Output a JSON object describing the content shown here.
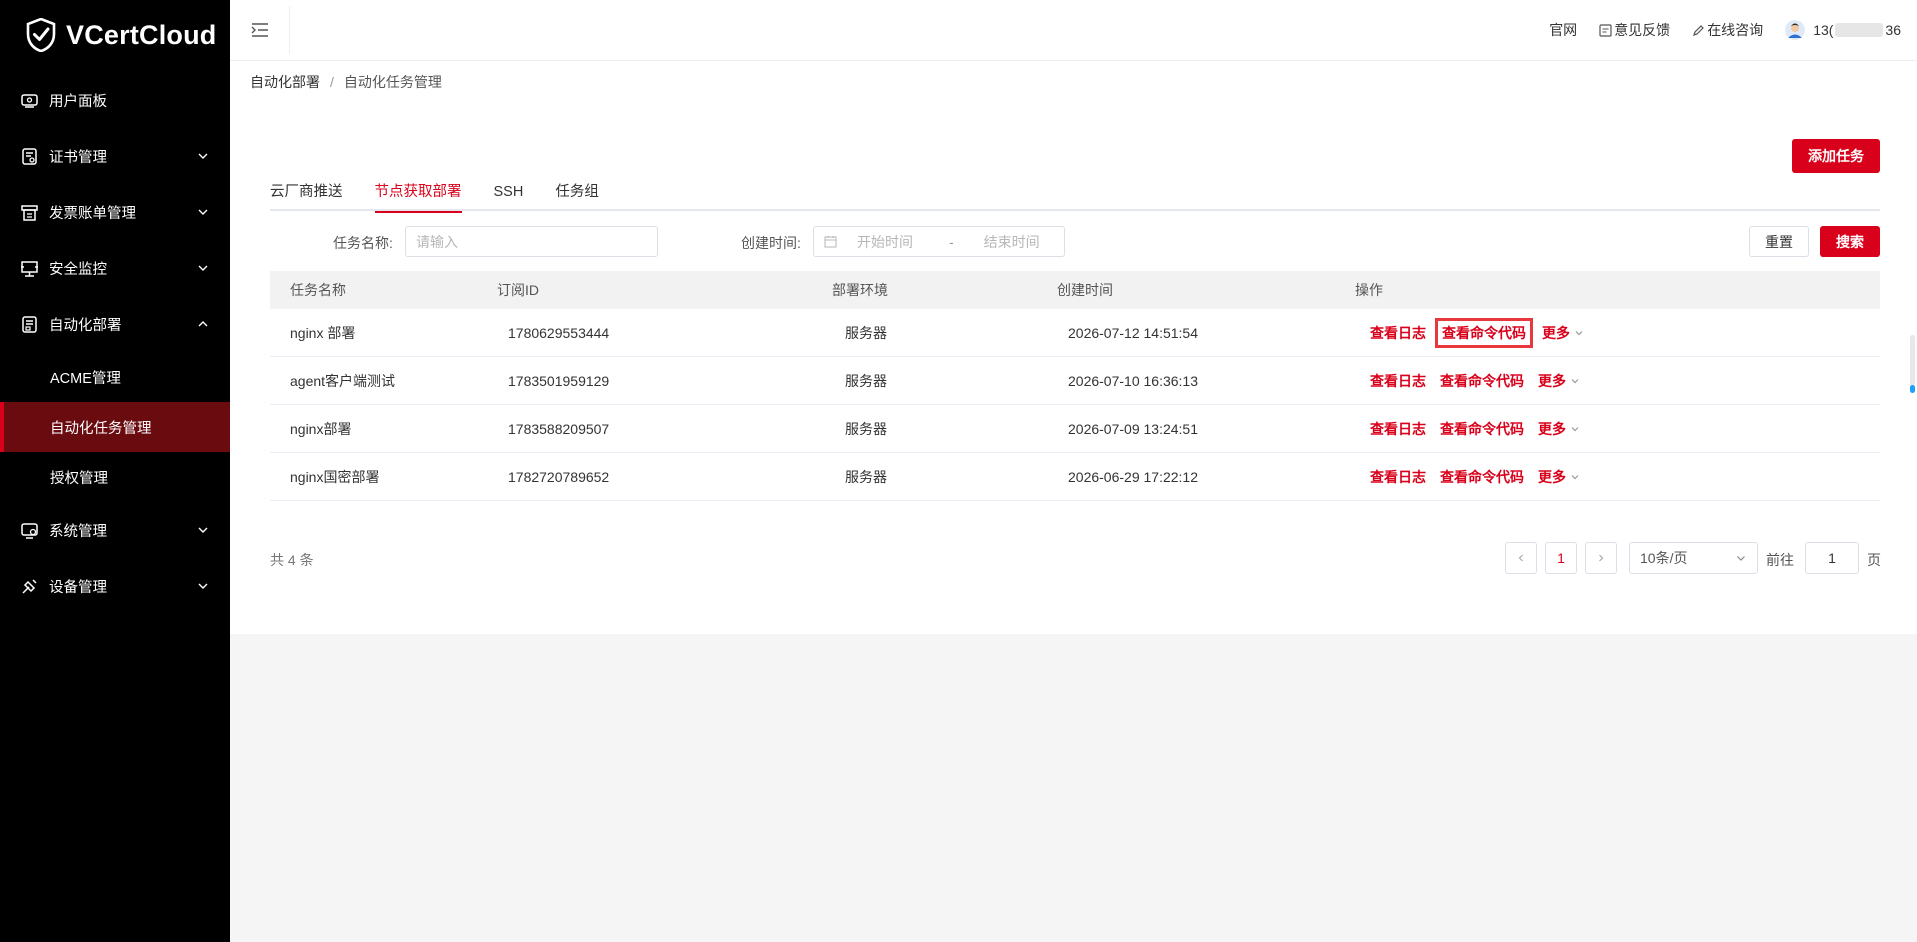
{
  "brand": {
    "name": "VCertCloud"
  },
  "sidebar": {
    "items": [
      {
        "label": "用户面板",
        "icon": "dashboard-icon",
        "has_children": false
      },
      {
        "label": "证书管理",
        "icon": "certificate-icon",
        "has_children": true
      },
      {
        "label": "发票账单管理",
        "icon": "invoice-icon",
        "has_children": true
      },
      {
        "label": "安全监控",
        "icon": "monitor-icon",
        "has_children": true
      },
      {
        "label": "自动化部署",
        "icon": "deploy-icon",
        "has_children": true,
        "expanded": true
      }
    ],
    "sub_items": [
      {
        "label": "ACME管理",
        "active": false
      },
      {
        "label": "自动化任务管理",
        "active": true
      },
      {
        "label": "授权管理",
        "active": false
      }
    ],
    "items_after": [
      {
        "label": "系统管理",
        "icon": "system-icon",
        "has_children": true
      },
      {
        "label": "设备管理",
        "icon": "device-icon",
        "has_children": true
      }
    ]
  },
  "header": {
    "links": [
      "官网",
      "意见反馈",
      "在线咨询"
    ],
    "user": {
      "prefix": "13(",
      "suffix": "36"
    }
  },
  "breadcrumb": {
    "parent": "自动化部署",
    "sep": "/",
    "current": "自动化任务管理"
  },
  "actions": {
    "add_task": "添加任务"
  },
  "tabs": [
    {
      "label": "云厂商推送",
      "active": false
    },
    {
      "label": "节点获取部署",
      "active": true
    },
    {
      "label": "SSH",
      "active": false
    },
    {
      "label": "任务组",
      "active": false
    }
  ],
  "filters": {
    "task_name_label": "任务名称:",
    "task_name_placeholder": "请输入",
    "created_label": "创建时间:",
    "start_placeholder": "开始时间",
    "range_sep": "-",
    "end_placeholder": "结束时间",
    "reset": "重置",
    "search": "搜索"
  },
  "table": {
    "columns": [
      "任务名称",
      "订阅ID",
      "部署环境",
      "创建时间",
      "操作"
    ],
    "rows": [
      {
        "name": "nginx 部署",
        "sub_id": "1780629553444",
        "env": "服务器",
        "created": "2026-07-12 14:51:54"
      },
      {
        "name": "agent客户端测试",
        "sub_id": "1783501959129",
        "env": "服务器",
        "created": "2026-07-10 16:36:13"
      },
      {
        "name": "nginx部署",
        "sub_id": "1783588209507",
        "env": "服务器",
        "created": "2026-07-09 13:24:51"
      },
      {
        "name": "nginx国密部署",
        "sub_id": "1782720789652",
        "env": "服务器",
        "created": "2026-06-29 17:22:12"
      }
    ],
    "ops": {
      "view_log": "查看日志",
      "view_cmd": "查看命令代码",
      "more": "更多"
    }
  },
  "pagination": {
    "total": "共 4 条",
    "current_page": "1",
    "page_size": "10条/页",
    "goto_label": "前往",
    "goto_value": "1",
    "page_unit": "页"
  },
  "colors": {
    "accent": "#d9001b",
    "sidebar_bg": "#000000",
    "active_bg": "#6a0b10"
  }
}
